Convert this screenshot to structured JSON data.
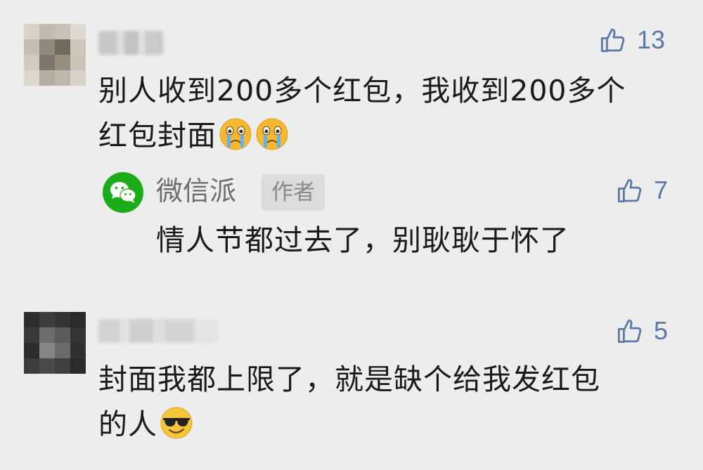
{
  "comments": [
    {
      "username": "",
      "likes": "13",
      "text_line1": "别人收到200多个红包，我收到200多个",
      "text_line2": "红包封面",
      "emojis": [
        "crying-face-emoji",
        "crying-face-emoji"
      ],
      "reply": {
        "name": "微信派",
        "badge": "作者",
        "likes": "7",
        "text": "情人节都过去了，别耿耿于怀了"
      }
    },
    {
      "username": "",
      "likes": "5",
      "text_line1": "封面我都上限了，就是缺个给我发红包",
      "text_line2": "的人",
      "emojis": [
        "sunglasses-face-emoji"
      ]
    }
  ],
  "colors": {
    "background": "#ededed",
    "like_blue": "#5a79a8",
    "wechat_green": "#1aad19",
    "badge_bg": "#dcdcdc"
  }
}
